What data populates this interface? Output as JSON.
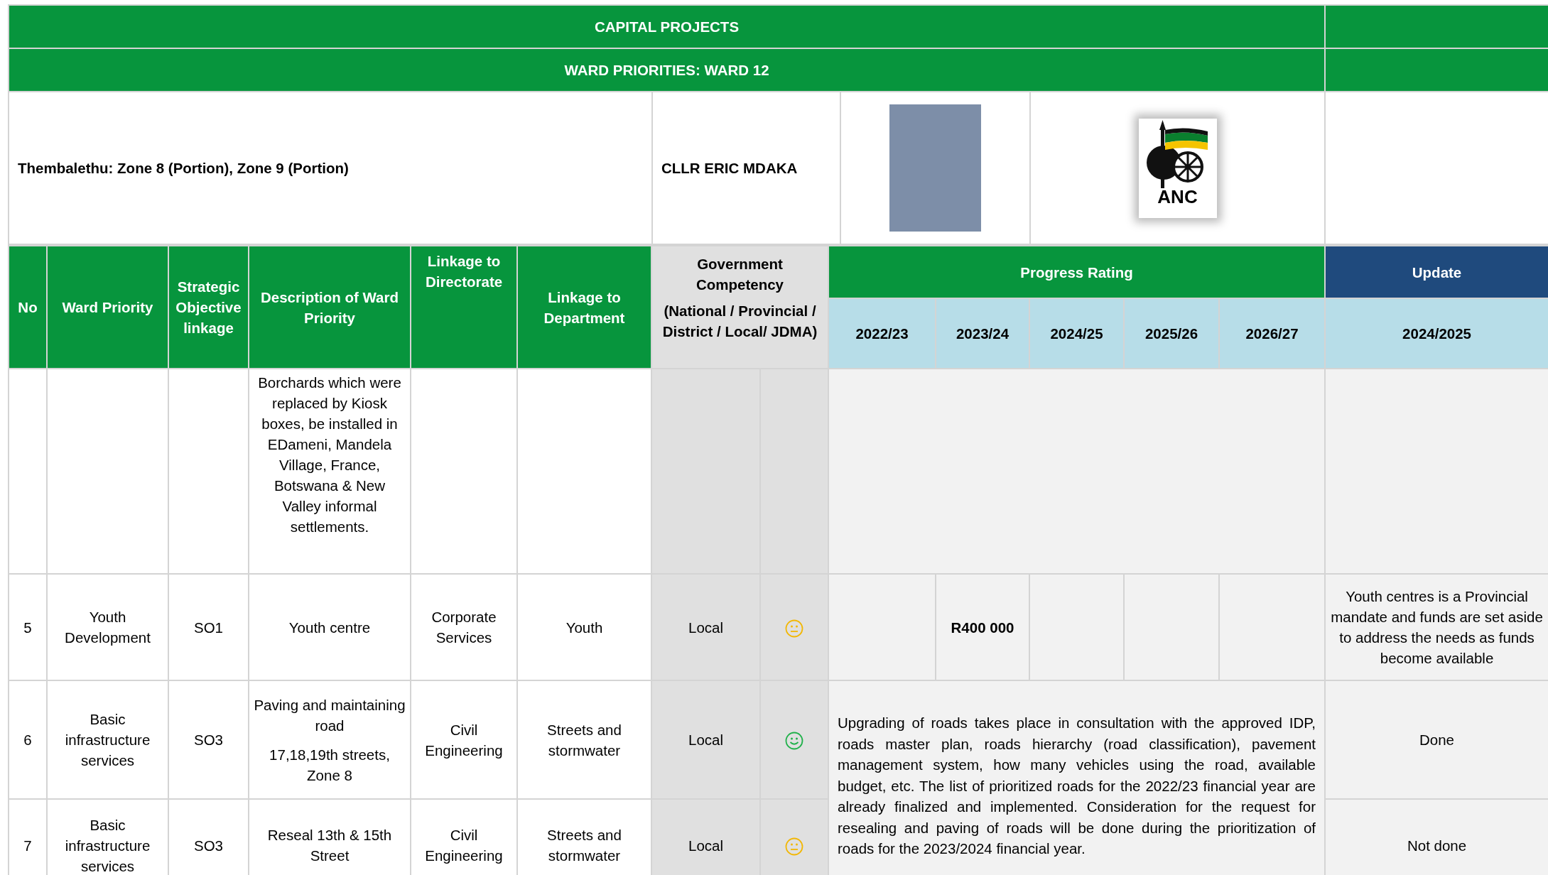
{
  "title": "CAPITAL PROJECTS",
  "subtitle": "WARD PRIORITIES: WARD 12",
  "area": "Thembalethu: Zone 8 (Portion), Zone 9 (Portion)",
  "councillor": "CLLR ERIC MDAKA",
  "logo_text": "ANC",
  "columns": {
    "no": "No",
    "priority": "Ward Priority",
    "objective": "Strategic Objective linkage",
    "description": "Description of Ward Priority",
    "directorate": "Linkage to Directorate",
    "department": "Linkage to Department",
    "competency": [
      "Government Competency",
      "(National / Provincial / District / Local/ JDMA)"
    ]
  },
  "progress_header": "Progress Rating",
  "update_header": "Update",
  "years": [
    "2022/23",
    "2023/24",
    "2024/25",
    "2025/26",
    "2026/27"
  ],
  "update_year": "2024/2025",
  "rows": [
    {
      "kind": "continuation",
      "description": [
        "Borchards which were replaced by Kiosk boxes, be installed in EDameni, Mandela Village, France, Botswana & New Valley informal settlements."
      ]
    },
    {
      "kind": "yearly",
      "no": "5",
      "priority": "Youth Development",
      "objective": "SO1",
      "description": [
        "Youth centre"
      ],
      "directorate": "Corporate Services",
      "department": "Youth",
      "competency": "Local",
      "rating": {
        "kind": "neutral",
        "color": "#f2b705"
      },
      "progress": [
        {
          "kind": "blank"
        },
        {
          "kind": "amount",
          "text": "R400 000"
        },
        {
          "kind": "blank"
        },
        {
          "kind": "blank"
        },
        {
          "kind": "blank"
        }
      ],
      "update": "Youth centres  is a Provincial mandate and funds are set aside to address the needs as funds become available"
    },
    {
      "kind": "commented",
      "no": "6",
      "priority": "Basic infrastructure services",
      "objective": "SO3",
      "description": [
        "Paving and maintaining road",
        "17,18,19th streets, Zone 8"
      ],
      "directorate": "Civil Engineering",
      "department": "Streets and stormwater",
      "competency": "Local",
      "rating": {
        "kind": "happy",
        "color": "#21b14b"
      },
      "comment": "Upgrading of roads takes place in consultation with the approved IDP, roads master plan, roads hierarchy (road classification), pavement management system, how many vehicles using the road, available budget, etc. The list of prioritized roads for the 2022/23 financial year are already finalized and implemented. Consideration for the request for resealing and paving of roads will be done during the prioritization of roads for the 2023/2024 financial year.",
      "update": "Done"
    },
    {
      "kind": "commented_cont",
      "no": "7",
      "priority": "Basic infrastructure services",
      "objective": "SO3",
      "description": [
        "Reseal 13th & 15th Street"
      ],
      "directorate": "Civil Engineering",
      "department": "Streets and stormwater",
      "competency": "Local",
      "rating": {
        "kind": "neutral",
        "color": "#f2b705"
      },
      "update": "Not done"
    }
  ]
}
